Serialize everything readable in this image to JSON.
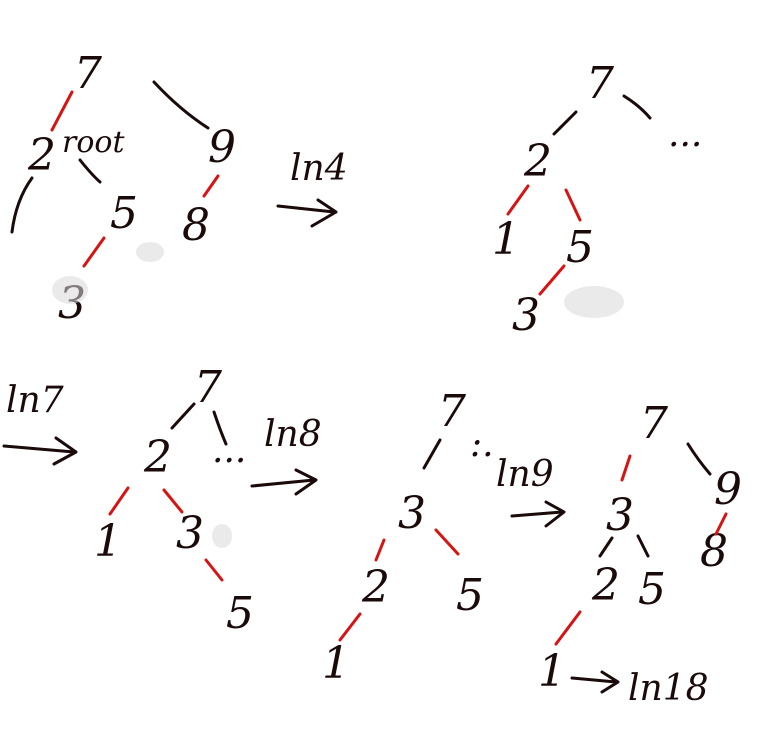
{
  "ink_colors": {
    "black": "#1a0a0a",
    "red": "#d61414"
  },
  "panel1": {
    "nodes": {
      "n7": "7",
      "n2": "2",
      "n5": "5",
      "n3": "3",
      "n9": "9",
      "n8": "8"
    },
    "root_label": "root"
  },
  "step1_label": "ln4",
  "panel2": {
    "nodes": {
      "n7": "7",
      "n2": "2",
      "n1": "1",
      "n5": "5",
      "n3": "3"
    },
    "ellipsis": "..."
  },
  "step2_label": "ln7",
  "panel3": {
    "nodes": {
      "n7": "7",
      "n2": "2",
      "n1": "1",
      "n3": "3",
      "n5": "5"
    },
    "ellipsis": "..."
  },
  "step3_label": "ln8",
  "panel4": {
    "nodes": {
      "n7": "7",
      "n3": "3",
      "n2": "2",
      "n5": "5",
      "n1": "1"
    },
    "ellipsis": ":."
  },
  "step4_label": "ln9",
  "panel5": {
    "nodes": {
      "n7": "7",
      "n9": "9",
      "n3": "3",
      "n8": "8",
      "n2": "2",
      "n5": "5",
      "n1": "1"
    }
  },
  "step5_label": "ln18"
}
